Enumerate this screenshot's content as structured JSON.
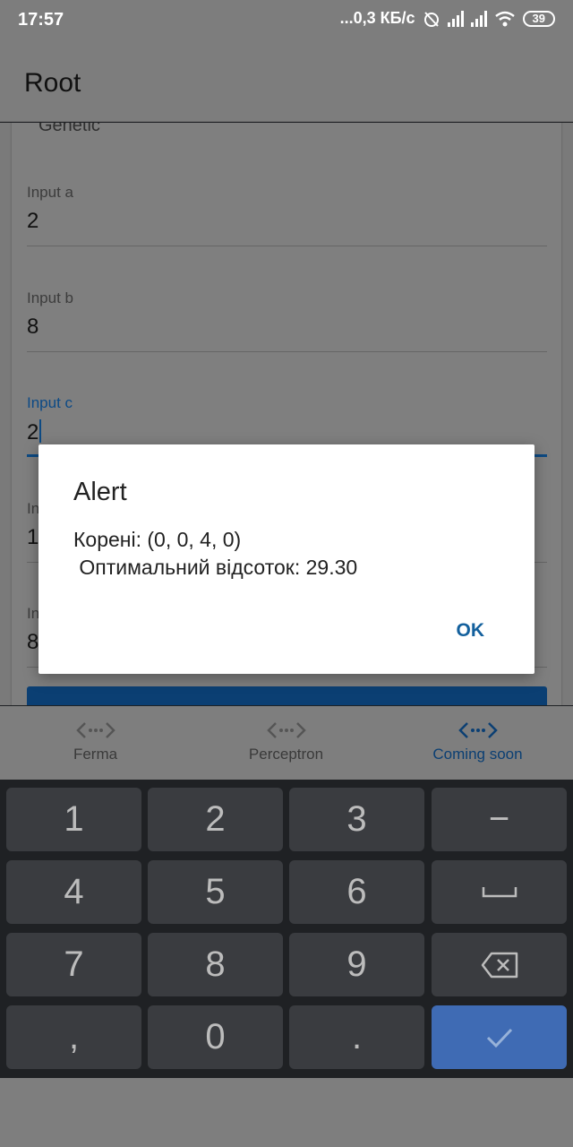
{
  "status": {
    "time": "17:57",
    "network": "...0,3 КБ/с",
    "battery": "39"
  },
  "app_bar": {
    "title": "Root"
  },
  "form": {
    "genetic_label": "Genetic",
    "fields": [
      {
        "label": "Input a",
        "value": "2"
      },
      {
        "label": "Input b",
        "value": "8"
      },
      {
        "label": "Input c",
        "value": "2"
      },
      {
        "label": "In",
        "value": "1"
      },
      {
        "label": "In",
        "value": "8"
      }
    ]
  },
  "tabs": [
    {
      "label": "Ferma",
      "icon": "code-arrows-icon"
    },
    {
      "label": "Perceptron",
      "icon": "code-arrows-icon"
    },
    {
      "label": "Coming soon",
      "icon": "code-arrows-icon",
      "active": true
    }
  ],
  "dialog": {
    "title": "Alert",
    "message": "Корені: (0, 0, 4, 0)\n Оптимальний відсоток: 29.30",
    "ok_label": "OK"
  },
  "keyboard": {
    "rows": [
      [
        "1",
        "2",
        "3",
        "−"
      ],
      [
        "4",
        "5",
        "6",
        "space"
      ],
      [
        "7",
        "8",
        "9",
        "backspace"
      ],
      [
        ",",
        "0",
        ".",
        "done"
      ]
    ]
  },
  "colors": {
    "accent": "#0d4a83",
    "dialog_ok": "#13609d",
    "keyboard_done": "#3f6bb4"
  }
}
